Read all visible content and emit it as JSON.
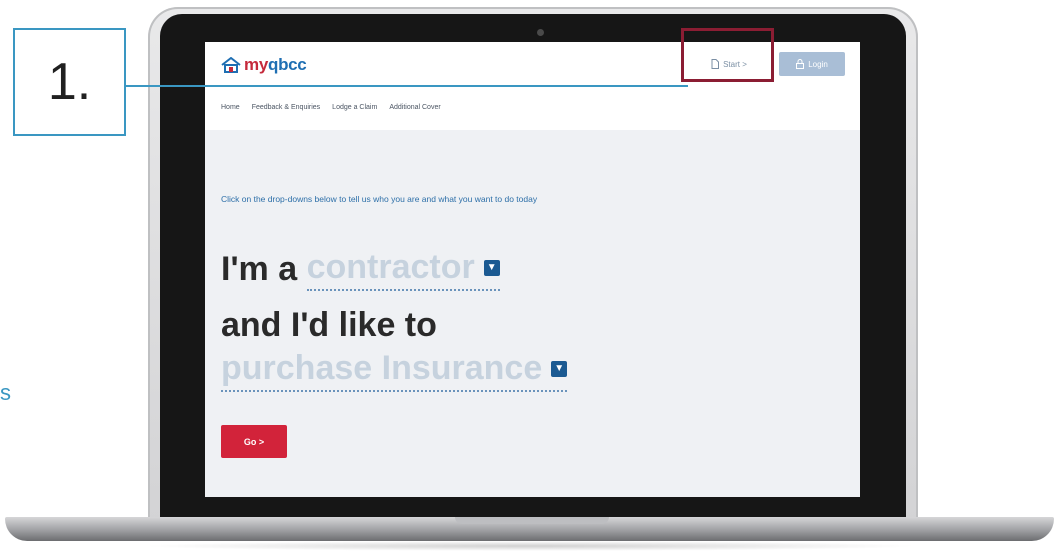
{
  "annotation": {
    "step_number": "1.",
    "side_text_fragment": "s",
    "accent_color": "#3a97c2",
    "highlight_color": "#8b1d33"
  },
  "website": {
    "logo": {
      "prefix": "my",
      "brand": "qbcc",
      "icon": "house-icon"
    },
    "header": {
      "start_button_label": "Start >",
      "start_icon": "document-icon",
      "login_button_label": "Login",
      "login_icon": "lock-icon"
    },
    "nav": [
      "Home",
      "Feedback & Enquiries",
      "Lodge a Claim",
      "Additional Cover"
    ],
    "prompt_text": "Click on the drop-downs below to tell us who you are and what you want to do today",
    "sentence": {
      "prefix": "I'm a",
      "role_value": "contractor",
      "middle": "and I'd like to",
      "action_value": "purchase Insurance"
    },
    "go_button_label": "Go >",
    "colors": {
      "brand_red": "#c52a3c",
      "brand_blue": "#1f6fb3",
      "dropdown_blue": "#1b5a92",
      "go_red": "#d2233a"
    }
  }
}
